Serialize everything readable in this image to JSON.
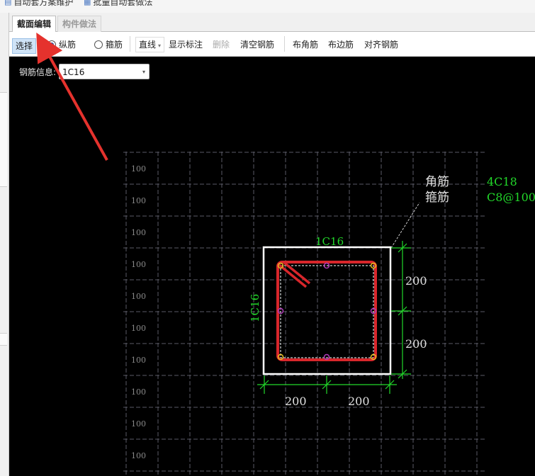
{
  "topbar": {
    "item1": {
      "label": "自动套方案维护",
      "icon": "document-icon"
    },
    "item2": {
      "label": "批量自动套做法",
      "icon": "batch-icon"
    }
  },
  "tabs": [
    {
      "label": "截面编辑",
      "active": true
    },
    {
      "label": "构件做法",
      "active": false
    }
  ],
  "toolbar": {
    "select": "选择",
    "longitudinal": "纵筋",
    "stirrup": "箍筋",
    "line_mode": "直线",
    "show_dims": "显示标注",
    "delete": "删除",
    "clear": "清空钢筋",
    "corner": "布角筋",
    "edge": "布边筋",
    "align": "对齐钢筋"
  },
  "rebar_info": {
    "label": "钢筋信息:",
    "value": "1C16"
  },
  "drawing": {
    "grid_label": "100",
    "top_bar": "1C16",
    "side_bar": "1C16",
    "leader_corner": "角筋",
    "leader_stirrup": "箍筋",
    "corner_spec": "4C18",
    "stirrup_spec": "C8@100",
    "dim_right_1": "200",
    "dim_right_2": "200",
    "dim_bottom_1": "200",
    "dim_bottom_2": "200"
  },
  "colors": {
    "canvas": "#000000",
    "grid": "#5a5a66",
    "section_outline": "#ffffff",
    "stirrup": "#d8262b",
    "dimension": "#22d82a",
    "rebar_point": "#b03ab8",
    "annotation": "#e0e0e0",
    "arrow": "#e5322d"
  }
}
